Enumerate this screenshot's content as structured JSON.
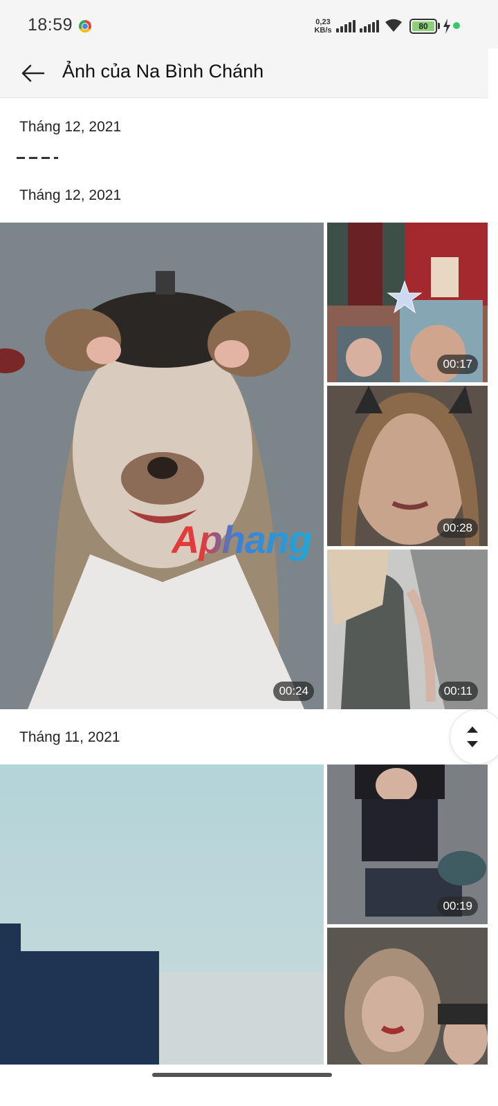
{
  "status_bar": {
    "time": "18:59",
    "net_speed_value": "0,23",
    "net_speed_unit": "KB/s",
    "battery_level": "80",
    "icons": [
      "chrome-icon",
      "signal-icon",
      "signal-icon",
      "wifi-icon",
      "battery-icon",
      "charging-icon",
      "green-dot"
    ]
  },
  "app_bar": {
    "title": "Ảnh của Na Bình Chánh",
    "back_icon": "arrow-left-icon"
  },
  "sections": [
    {
      "label": "Tháng 12, 2021"
    },
    {
      "label": "Tháng 12, 2021"
    },
    {
      "label": "Tháng 11, 2021"
    }
  ],
  "media": {
    "dec_main": {
      "duration": "00:24",
      "watermark": "Aphang"
    },
    "dec_top_right": {
      "duration": "00:17"
    },
    "dec_middle_right": {
      "duration": "00:28"
    },
    "dec_bottom_right": {
      "duration": "00:11"
    },
    "nov_top_right": {
      "duration": "00:19"
    }
  },
  "colors": {
    "app_bar_bg": "#f5f5f5",
    "badge_bg": "#282828",
    "battery_fill": "#8cd07a",
    "accent_dot": "#37c76c"
  }
}
